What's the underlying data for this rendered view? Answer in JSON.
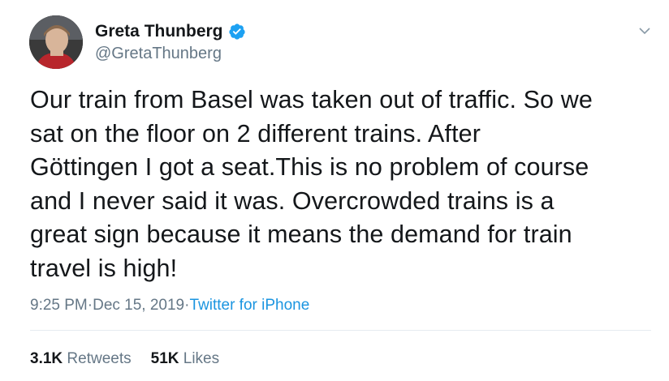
{
  "user": {
    "display_name": "Greta Thunberg",
    "handle": "@GretaThunberg",
    "verified": true
  },
  "tweet": {
    "text": "Our train from Basel was taken out of traffic. So we\nsat on the floor on 2 different trains. After\nGöttingen I got a seat.This is no problem of course\nand I never said it was. Overcrowded trains is a\ngreat sign because it means the demand for train\ntravel is high!",
    "time": "9:25 PM",
    "separator": " · ",
    "date": "Dec 15, 2019",
    "source": "Twitter for iPhone"
  },
  "stats": {
    "retweets_count": "3.1K",
    "retweets_label": "Retweets",
    "likes_count": "51K",
    "likes_label": "Likes"
  },
  "icons": {
    "verified": "verified-badge-icon",
    "caret": "chevron-down-icon"
  },
  "colors": {
    "text": "#14171a",
    "secondary": "#657786",
    "link": "#1b95e0",
    "verified": "#1da1f2",
    "divider": "#e6ecf0"
  }
}
